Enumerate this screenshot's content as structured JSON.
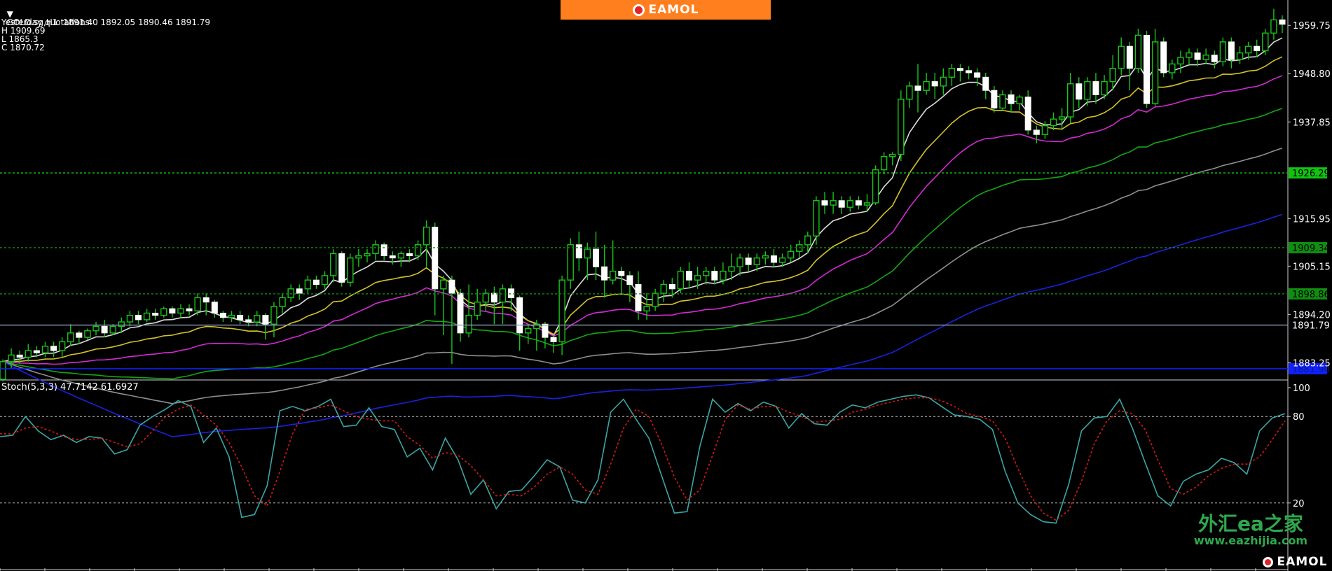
{
  "header": {
    "symbol_line": "GOLD.sg,H1  1891.40 1892.05 1890.46 1891.79",
    "yesterday_title": "Yesterday quotations:",
    "high": "H 1909.69",
    "low": "L 1865.3",
    "close": "C 1870.72"
  },
  "brand": {
    "logo_text": "EAMOL",
    "color": "#ff7f1e"
  },
  "watermark": {
    "chinese": "外汇ea之家",
    "url": "www.eazhijia.com",
    "color": "#2fa84d"
  },
  "price_axis": {
    "labels": [
      "1959.75",
      "1948.80",
      "1937.85",
      "1915.95",
      "1905.15",
      "1894.20",
      "1883.25"
    ],
    "range": [
      1879.5,
      1965.5
    ]
  },
  "levels": [
    {
      "value": 1926.29,
      "label": "1926.29",
      "style": "dotted",
      "line_color": "#12c212",
      "label_bg": "#12c212",
      "label_color": "#000"
    },
    {
      "value": 1909.34,
      "label": "1909.34",
      "style": "dotted",
      "line_color": "#0f8f0f",
      "label_bg": "#0f8f0f",
      "label_color": "#000"
    },
    {
      "value": 1898.86,
      "label": "1898.86",
      "style": "dotted",
      "line_color": "#0f8f0f",
      "label_bg": "#0f8f0f",
      "label_color": "#000"
    },
    {
      "value": 1891.79,
      "label": "1891.79",
      "style": "solid",
      "line_color": "#8fa0b8",
      "label_bg": "#000",
      "label_color": "#fff"
    },
    {
      "value": 1881.9,
      "label": "1881.90",
      "style": "solid",
      "line_color": "#1020ff",
      "label_bg": "#1020ff",
      "label_color": "#0b1a8a"
    }
  ],
  "stoch": {
    "title": "Stoch(5,3,3) 47.7142 61.6927",
    "axis_labels": [
      "100",
      "80",
      "20"
    ],
    "levels": [
      80,
      20
    ],
    "main_color": "#3aa6a4",
    "signal_color": "#d81818",
    "main": [
      66,
      67,
      80,
      70,
      64,
      67,
      62,
      66,
      65,
      54,
      57,
      74,
      80,
      85,
      91,
      87,
      62,
      72,
      52,
      10,
      12,
      32,
      84,
      87,
      84,
      87,
      92,
      73,
      74,
      86,
      73,
      71,
      52,
      58,
      43,
      65,
      50,
      26,
      36,
      16,
      28,
      29,
      39,
      50,
      45,
      22,
      20,
      36,
      83,
      92,
      78,
      65,
      39,
      13,
      14,
      59,
      92,
      83,
      89,
      84,
      90,
      87,
      72,
      82,
      75,
      74,
      83,
      88,
      86,
      90,
      92,
      94,
      95,
      93,
      87,
      81,
      80,
      78,
      71,
      42,
      20,
      12,
      7,
      6,
      33,
      70,
      79,
      80,
      92,
      72,
      48,
      25,
      18,
      35,
      40,
      43,
      51,
      48,
      40,
      70,
      79,
      82
    ],
    "signal": [
      68,
      68,
      72,
      73,
      70,
      66,
      64,
      64,
      65,
      62,
      59,
      61,
      70,
      80,
      85,
      88,
      81,
      74,
      62,
      45,
      25,
      18,
      42,
      68,
      85,
      86,
      88,
      84,
      80,
      78,
      77,
      77,
      66,
      60,
      51,
      55,
      53,
      46,
      36,
      25,
      26,
      25,
      31,
      40,
      45,
      40,
      29,
      26,
      47,
      72,
      85,
      80,
      61,
      38,
      22,
      29,
      53,
      78,
      88,
      85,
      87,
      87,
      83,
      80,
      76,
      77,
      78,
      83,
      85,
      88,
      90,
      92,
      93,
      93,
      91,
      87,
      82,
      80,
      77,
      65,
      44,
      25,
      13,
      8,
      15,
      35,
      61,
      77,
      84,
      82,
      71,
      50,
      30,
      26,
      31,
      39,
      44,
      47,
      47,
      52,
      64,
      77
    ]
  },
  "candles": [
    [
      1879.5,
      1883.5,
      1879,
      1884
    ],
    [
      1883.5,
      1885,
      1882,
      1886.5
    ],
    [
      1885,
      1884.5,
      1883,
      1886
    ],
    [
      1884.5,
      1886,
      1883.5,
      1887.5
    ],
    [
      1886,
      1885.5,
      1884.5,
      1887
    ],
    [
      1885.5,
      1887,
      1884.5,
      1888
    ],
    [
      1887,
      1886,
      1884.5,
      1888
    ],
    [
      1886,
      1888,
      1884.5,
      1889
    ],
    [
      1888,
      1890,
      1887,
      1892
    ],
    [
      1890,
      1889,
      1887.5,
      1890.5
    ],
    [
      1889,
      1890.5,
      1888.5,
      1891
    ],
    [
      1890.5,
      1891.5,
      1889.5,
      1892.5
    ],
    [
      1891.5,
      1890,
      1889,
      1893
    ],
    [
      1890,
      1891.5,
      1889.5,
      1892
    ],
    [
      1891.5,
      1892.5,
      1890,
      1893.5
    ],
    [
      1892.5,
      1894,
      1891.5,
      1895
    ],
    [
      1894,
      1893,
      1892,
      1895
    ],
    [
      1893,
      1894.5,
      1892.5,
      1895.5
    ],
    [
      1894.5,
      1894,
      1893,
      1895.5
    ],
    [
      1894,
      1895.5,
      1893.5,
      1896
    ],
    [
      1895.5,
      1894.5,
      1893.5,
      1896
    ],
    [
      1894.5,
      1895.5,
      1893.5,
      1896.5
    ],
    [
      1895.5,
      1895,
      1894,
      1896.5
    ],
    [
      1895,
      1898,
      1894,
      1899
    ],
    [
      1898,
      1897,
      1894,
      1899
    ],
    [
      1897,
      1894.5,
      1893.5,
      1897.5
    ],
    [
      1894.5,
      1893.5,
      1892.5,
      1895
    ],
    [
      1893.5,
      1894,
      1892.5,
      1895
    ],
    [
      1894,
      1893,
      1892,
      1895
    ],
    [
      1893,
      1892.5,
      1891.5,
      1894
    ],
    [
      1892.5,
      1894,
      1891.5,
      1895
    ],
    [
      1894,
      1892,
      1888.5,
      1894.5
    ],
    [
      1892,
      1896,
      1889,
      1897
    ],
    [
      1896,
      1898,
      1894.5,
      1899
    ],
    [
      1898,
      1900,
      1897,
      1901
    ],
    [
      1900,
      1899,
      1897.5,
      1901
    ],
    [
      1900,
      1902,
      1899,
      1903
    ],
    [
      1902,
      1901,
      1900,
      1903
    ],
    [
      1901,
      1903,
      1900,
      1904
    ],
    [
      1903,
      1908,
      1901.5,
      1909
    ],
    [
      1908,
      1901.5,
      1900.5,
      1908.5
    ],
    [
      1901.5,
      1907,
      1900.5,
      1908
    ],
    [
      1907,
      1907.5,
      1905,
      1909
    ],
    [
      1907.5,
      1908,
      1906,
      1909
    ],
    [
      1908,
      1910,
      1906.5,
      1911
    ],
    [
      1910,
      1907.5,
      1906.5,
      1910.5
    ],
    [
      1907.5,
      1907,
      1905.5,
      1908.5
    ],
    [
      1907,
      1908,
      1905,
      1908.5
    ],
    [
      1908,
      1907.5,
      1906,
      1909
    ],
    [
      1907.5,
      1910,
      1906.5,
      1911
    ],
    [
      1910,
      1914,
      1905,
      1915.5
    ],
    [
      1914,
      1900,
      1894,
      1915
    ],
    [
      1900,
      1902,
      1889.5,
      1903
    ],
    [
      1902,
      1899,
      1883,
      1903
    ],
    [
      1899,
      1890,
      1888,
      1900
    ],
    [
      1890,
      1894,
      1889,
      1901
    ],
    [
      1894,
      1897,
      1893,
      1900
    ],
    [
      1897,
      1899,
      1895,
      1900
    ],
    [
      1899,
      1897,
      1892,
      1900.5
    ],
    [
      1897,
      1900,
      1892,
      1901
    ],
    [
      1900,
      1898,
      1895,
      1901
    ],
    [
      1898,
      1890,
      1886,
      1898.5
    ],
    [
      1890,
      1891,
      1887.5,
      1892
    ],
    [
      1891,
      1892,
      1886,
      1893
    ],
    [
      1892,
      1889,
      1886.5,
      1892.5
    ],
    [
      1889,
      1888,
      1885.5,
      1889.5
    ],
    [
      1888,
      1902,
      1885,
      1903
    ],
    [
      1902,
      1910,
      1900,
      1911.5
    ],
    [
      1910,
      1907,
      1904,
      1913
    ],
    [
      1907,
      1909,
      1902,
      1910.5
    ],
    [
      1909,
      1905,
      1902,
      1913
    ],
    [
      1905,
      1902,
      1898,
      1910
    ],
    [
      1902,
      1904,
      1901,
      1911
    ],
    [
      1904,
      1903,
      1899,
      1905
    ],
    [
      1903,
      1901,
      1897,
      1904
    ],
    [
      1901,
      1895,
      1893,
      1904
    ],
    [
      1895,
      1896,
      1893,
      1899
    ],
    [
      1896,
      1899,
      1895,
      1900
    ],
    [
      1899,
      1901,
      1897,
      1902
    ],
    [
      1901,
      1900,
      1898,
      1902.5
    ],
    [
      1900,
      1904,
      1899,
      1905
    ],
    [
      1904,
      1902,
      1900,
      1906
    ],
    [
      1902,
      1903,
      1900,
      1905
    ],
    [
      1903,
      1904,
      1901,
      1905
    ],
    [
      1904,
      1902,
      1901,
      1905
    ],
    [
      1902,
      1904,
      1901,
      1906
    ],
    [
      1904,
      1905,
      1902,
      1908
    ],
    [
      1905,
      1907,
      1903,
      1908
    ],
    [
      1907,
      1905.5,
      1904,
      1908
    ],
    [
      1905.5,
      1907,
      1904,
      1908
    ],
    [
      1907,
      1907.5,
      1905.5,
      1908.5
    ],
    [
      1907.5,
      1906,
      1905,
      1909
    ],
    [
      1906,
      1907,
      1905,
      1908
    ],
    [
      1907,
      1908.5,
      1906,
      1910
    ],
    [
      1908.5,
      1910,
      1907,
      1911
    ],
    [
      1910,
      1912,
      1908,
      1913
    ],
    [
      1912,
      1920,
      1910,
      1921
    ],
    [
      1920,
      1919,
      1917,
      1922
    ],
    [
      1919,
      1920,
      1917,
      1922
    ],
    [
      1920,
      1918.5,
      1917,
      1921
    ],
    [
      1918.5,
      1920,
      1917.5,
      1921
    ],
    [
      1920,
      1919,
      1918,
      1921
    ],
    [
      1919,
      1919.5,
      1917.5,
      1921.5
    ],
    [
      1919.5,
      1927,
      1919,
      1928
    ],
    [
      1927,
      1930,
      1926,
      1931
    ],
    [
      1930,
      1930.5,
      1928,
      1931
    ],
    [
      1930.5,
      1943,
      1929,
      1945
    ],
    [
      1943,
      1946,
      1941,
      1947
    ],
    [
      1946,
      1945,
      1940,
      1951
    ],
    [
      1945,
      1947,
      1944,
      1949
    ],
    [
      1947,
      1946,
      1943,
      1949
    ],
    [
      1946,
      1948,
      1944,
      1950
    ],
    [
      1948,
      1950,
      1946,
      1951
    ],
    [
      1950,
      1949.5,
      1947,
      1951
    ],
    [
      1949.5,
      1949,
      1947.5,
      1950.5
    ],
    [
      1949,
      1948,
      1946,
      1950
    ],
    [
      1948,
      1945,
      1943,
      1949
    ],
    [
      1945,
      1941,
      1940,
      1946
    ],
    [
      1941,
      1944,
      1940.5,
      1945
    ],
    [
      1944,
      1942,
      1940,
      1945
    ],
    [
      1942,
      1943.5,
      1940.5,
      1944
    ],
    [
      1943.5,
      1936,
      1935,
      1945
    ],
    [
      1936,
      1935,
      1933,
      1937
    ],
    [
      1935,
      1937,
      1934,
      1938
    ],
    [
      1937,
      1938.5,
      1936,
      1940
    ],
    [
      1938.5,
      1939,
      1936,
      1941
    ],
    [
      1939,
      1946.5,
      1937.5,
      1949
    ],
    [
      1946.5,
      1943,
      1941,
      1948
    ],
    [
      1943,
      1947,
      1941.5,
      1948
    ],
    [
      1947,
      1944,
      1942,
      1949
    ],
    [
      1944,
      1947,
      1943,
      1948.5
    ],
    [
      1947,
      1950,
      1945,
      1953
    ],
    [
      1950,
      1955,
      1948.5,
      1957
    ],
    [
      1955,
      1950,
      1945,
      1956
    ],
    [
      1950,
      1957.5,
      1949,
      1959
    ],
    [
      1957.5,
      1942,
      1941,
      1958.5
    ],
    [
      1942,
      1956,
      1941.5,
      1959
    ],
    [
      1956,
      1949,
      1948,
      1957
    ],
    [
      1949,
      1951,
      1947.5,
      1952
    ],
    [
      1951,
      1952.5,
      1949,
      1954
    ],
    [
      1952.5,
      1953.5,
      1950.5,
      1954.5
    ],
    [
      1953.5,
      1952,
      1950.5,
      1954.5
    ],
    [
      1952,
      1953,
      1951,
      1954.5
    ],
    [
      1953,
      1951.5,
      1950,
      1954
    ],
    [
      1951.5,
      1956,
      1950.5,
      1957
    ],
    [
      1956,
      1952,
      1950,
      1957
    ],
    [
      1952,
      1953.5,
      1951,
      1955
    ],
    [
      1953.5,
      1955,
      1952,
      1956
    ],
    [
      1955,
      1954,
      1952.5,
      1956.5
    ],
    [
      1954,
      1958,
      1953,
      1959
    ],
    [
      1958,
      1961,
      1956.5,
      1963.5
    ],
    [
      1961,
      1960,
      1958,
      1962
    ]
  ]
}
